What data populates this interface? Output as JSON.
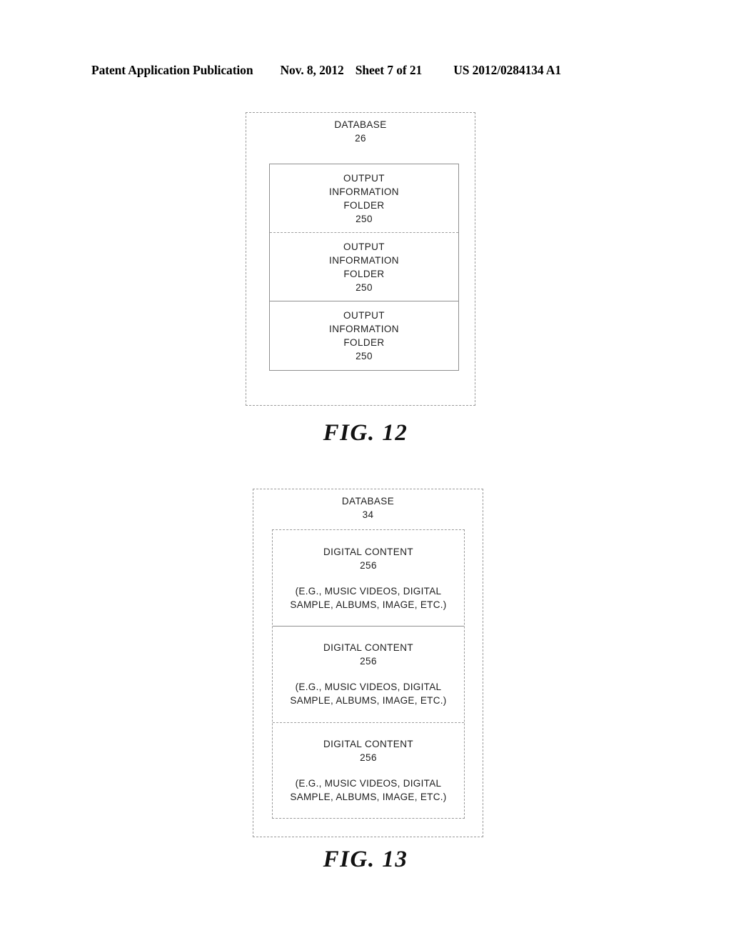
{
  "header": {
    "publication": "Patent Application Publication",
    "date": "Nov. 8, 2012",
    "sheet": "Sheet 7 of 21",
    "document_number": "US 2012/0284134 A1"
  },
  "figures": [
    {
      "caption": "FIG. 12",
      "container": {
        "title": "DATABASE\n26"
      },
      "cells": [
        {
          "main": "OUTPUT\nINFORMATION\nFOLDER\n250",
          "sub": ""
        },
        {
          "main": "OUTPUT\nINFORMATION\nFOLDER\n250",
          "sub": ""
        },
        {
          "main": "OUTPUT\nINFORMATION\nFOLDER\n250",
          "sub": ""
        }
      ]
    },
    {
      "caption": "FIG. 13",
      "container": {
        "title": "DATABASE\n34"
      },
      "cells": [
        {
          "main": "DIGITAL CONTENT\n256",
          "sub": "(E.G., MUSIC VIDEOS, DIGITAL\nSAMPLE, ALBUMS, IMAGE, ETC.)"
        },
        {
          "main": "DIGITAL CONTENT\n256",
          "sub": "(E.G., MUSIC VIDEOS, DIGITAL\nSAMPLE, ALBUMS, IMAGE, ETC.)"
        },
        {
          "main": "DIGITAL CONTENT\n256",
          "sub": "(E.G., MUSIC VIDEOS, DIGITAL\nSAMPLE, ALBUMS, IMAGE, ETC.)"
        }
      ]
    }
  ],
  "colors": {
    "ink": "#1c1c1c",
    "rule": "#8f8f8f",
    "dashed_rule": "#9a9a9a",
    "page_background": "#ffffff"
  }
}
